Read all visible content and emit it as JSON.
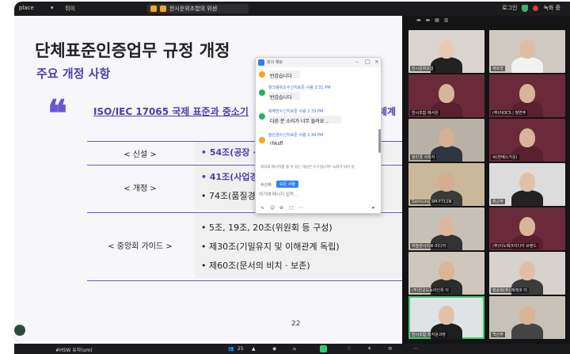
{
  "topbar": {
    "app_label": "place",
    "profile_label": "쥐이",
    "tab_label": "한시운위조합의 위센",
    "right_label": "로그인",
    "rec_label": "녹화 중"
  },
  "slide": {
    "title": "단체표준인증업무 규정 개정",
    "subtitle": "주요 개정 사항",
    "quote_mark": "❝",
    "heading": "ISO/IEC 17065 국제 표준과 중소기",
    "heading_tail": "체계",
    "rows": [
      {
        "label": "< 신설 >",
        "lines": [
          "• 54조(공장 ·"
        ]
      },
      {
        "label": "< 개정 >",
        "lines": [
          "• 41조(사업경",
          "• 74조(품질경"
        ]
      },
      {
        "label": "< 중앙회 가이드 >",
        "lines": [
          "• 5조, 19조, 20조(위원회 등 구성)",
          "• 제30조(기밀유지 및 이해관계 독립)",
          "• 제60조(문서의 비치 · 보존)"
        ]
      }
    ],
    "page_number": "22"
  },
  "chat": {
    "title": "회의 채팅",
    "messages": [
      {
        "name": "",
        "text": "반갑습니다",
        "avatar_color": "#f5a623"
      },
      {
        "name": "힐크롤위소수신지로준 사람 2:31 PM",
        "text": "반갑습니다",
        "avatar_color": "#27ae60"
      },
      {
        "name": "박채한수신지로준 사람 2:33 PM",
        "text": "다른 분 소리가 너무 들려요 ..",
        "avatar_color": "#27ae60"
      },
      {
        "name": "정민경수신지로준 사람 2:34 PM",
        "text": "rhksfl",
        "avatar_color": "#f5a623"
      }
    ],
    "note": "회의의 메시지를 볼 수 있는 대상은 누구입니까? 녹화가 되어 있",
    "to_label": "수신자:",
    "to_button": "모든 사람",
    "input_placeholder": "여기에 메시지 입력...",
    "send_icon": "send-icon"
  },
  "gallery": {
    "controls": "▬ ▬ ▦ ▥",
    "tiles": [
      {
        "name": "한시운위조합",
        "bg": "#d9d4cf",
        "skin": "#e8c9b5",
        "shirt": "#222"
      },
      {
        "name": "채호형",
        "bg": "#cfc9c2",
        "skin": "#e0bda5",
        "shirt": "#f2f2f2"
      },
      {
        "name": "한시조합 에서은",
        "bg": "#6a2a3a",
        "skin": "#d8b49a",
        "shirt": "#5a2030"
      },
      {
        "name": "(주)이OCS | 정연주",
        "bg": "#6a2a3a",
        "skin": "#d8b49a",
        "shirt": "#5a2030"
      },
      {
        "name": "정만경 사회자",
        "bg": "#b9b1a6",
        "skin": "#d6b195",
        "shirt": "#303640"
      },
      {
        "name": "씨(한베스가운)",
        "bg": "#6a2a3a",
        "skin": "#d8b49a",
        "shirt": "#5a2030"
      },
      {
        "name": "Samsung SM-F711N",
        "bg": "#c9b89a",
        "skin": "#d4ae90",
        "shirt": "#3a3a3a"
      },
      {
        "name": "최근주",
        "bg": "#dcdcdc",
        "skin": "#e3c1a8",
        "shirt": "#222"
      },
      {
        "name": "자슬관시리로-미디어",
        "bg": "#c7c0b6",
        "skin": "#dcb79c",
        "shirt": "#333"
      },
      {
        "name": "(주)이노텍크이디어 브랜드",
        "bg": "#6a2a3a",
        "skin": "#d8b49a",
        "shirt": "#5a2030"
      },
      {
        "name": "(주)한교도동아인위 이",
        "bg": "#cfc7bb",
        "skin": "#dab596",
        "shirt": "#2c2c2c"
      },
      {
        "name": "정순희(주) 에레코 이",
        "bg": "#d7d2cb",
        "skin": "#e0bfa6",
        "shirt": "#3c3c3c"
      },
      {
        "name": "한시조합 최자윤과장",
        "bg": "#dfe3e6",
        "skin": "#e2c1a8",
        "shirt": "#1e1e1e"
      },
      {
        "name": "백산부",
        "bg": "#c8c1b7",
        "skin": "#d9b497",
        "shirt": "#444"
      }
    ]
  },
  "bottombar": {
    "left_label": "#HSW 유자(um)",
    "participants": "25",
    "items": [
      "▲",
      "◉",
      "⌂",
      "♡",
      "⚘",
      "⟲",
      "⋯"
    ]
  }
}
